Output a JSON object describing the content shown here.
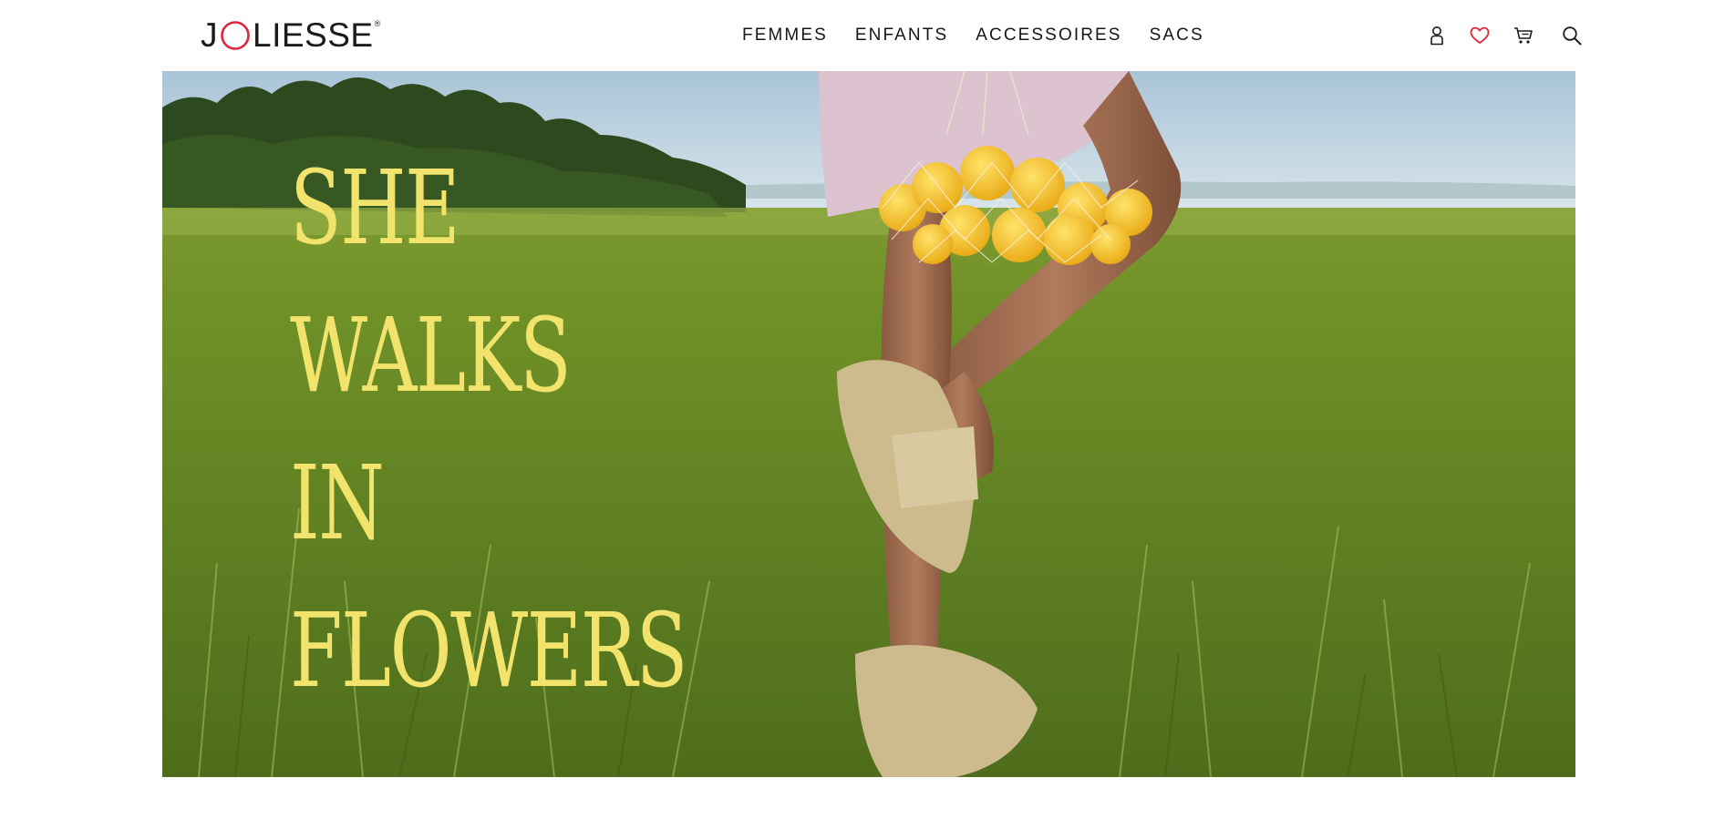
{
  "brand": {
    "logo_prefix": "J",
    "logo_suffix": "LIESSE",
    "registered_mark": "®",
    "logo_accent_color": "#e0243c"
  },
  "nav": {
    "items": [
      {
        "label": "FEMMES"
      },
      {
        "label": "ENFANTS"
      },
      {
        "label": "ACCESSOIRES"
      },
      {
        "label": "SACS"
      }
    ]
  },
  "header_icons": [
    {
      "name": "user-icon"
    },
    {
      "name": "heart-icon",
      "color": "#e0243c"
    },
    {
      "name": "cart-icon"
    },
    {
      "name": "search-icon"
    }
  ],
  "hero": {
    "headline_lines": [
      "SHE",
      "WALKS",
      "IN",
      "FLOWERS"
    ],
    "headline_color": "#f1e36b",
    "image_description_colors": {
      "sky": "#b9d3e2",
      "grass": "#6e8f2a",
      "lemons": "#f2c41e",
      "sandal": "#d9c9a0"
    }
  }
}
